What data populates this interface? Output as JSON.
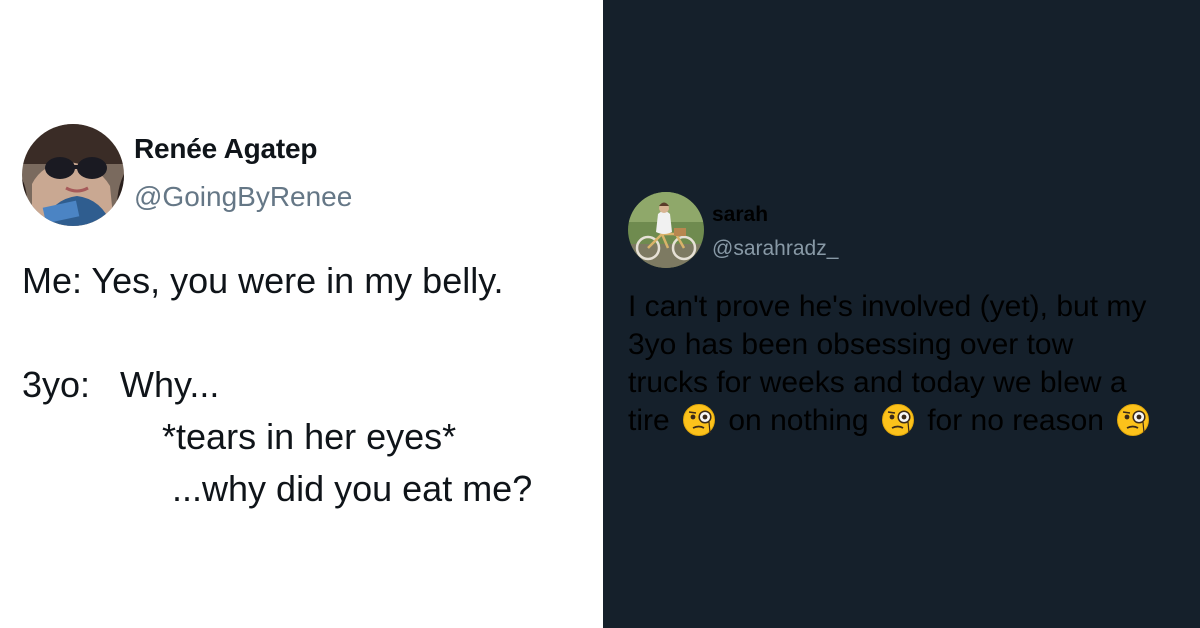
{
  "left_tweet": {
    "author_name": "Renée Agatep",
    "handle": "@GoingByRenee",
    "avatar_icon": "profile-photo-sunglasses",
    "text": "Me: Yes, you were in my belly.\n\n3yo:   Why...\n              *tears in her eyes*\n               ...why did you eat me?"
  },
  "right_tweet": {
    "author_name": "sarah",
    "handle": "@sarahradz_",
    "avatar_icon": "profile-photo-bicycle",
    "text_line1": "I can't prove he's involved (yet), but my",
    "text_line2": "3yo has been obsessing over tow",
    "text_line3": "trucks for weeks and today we blew a",
    "text_line4_part1": "tire",
    "text_line4_part2": "on nothing",
    "text_line4_part3": "for no reason",
    "emoji_icon": "face-with-monocle-emoji"
  },
  "colors": {
    "light_bg": "#ffffff",
    "dark_bg": "#15202b",
    "light_handle": "#657786",
    "dark_handle": "#8899a6"
  }
}
